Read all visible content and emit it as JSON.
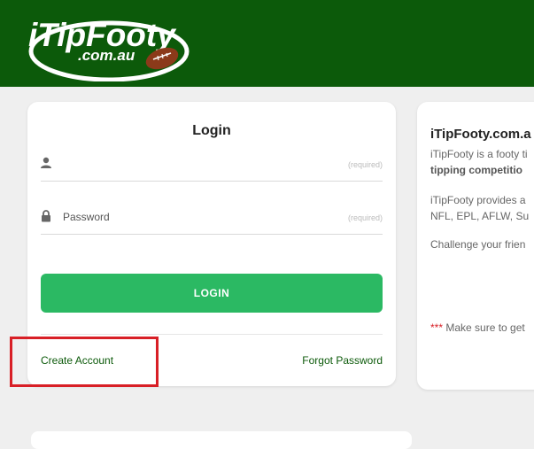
{
  "header": {
    "brand": "iTipFooty",
    "domain": ".com.au",
    "colors": {
      "bg": "#0c5a0a"
    }
  },
  "login": {
    "title": "Login",
    "username_placeholder": "",
    "username_required": "(required)",
    "password_placeholder": "Password",
    "password_required": "(required)",
    "login_button": "LOGIN",
    "create_account": "Create Account",
    "forgot_password": "Forgot Password",
    "colors": {
      "button": "#2bb963",
      "links": "#0c5a0a"
    }
  },
  "info": {
    "title": "iTipFooty.com.a",
    "p1_line1": "iTipFooty is a footy ti",
    "p1_line2_bold": "tipping competitio",
    "p2_line1": "iTipFooty provides a",
    "p2_line2": "NFL, EPL, AFLW, Su",
    "p3": "Challenge your frien",
    "p4_asterisks": "***",
    "p4_text": " Make sure to get"
  },
  "annotation": {
    "highlight_color": "#d81f26"
  }
}
